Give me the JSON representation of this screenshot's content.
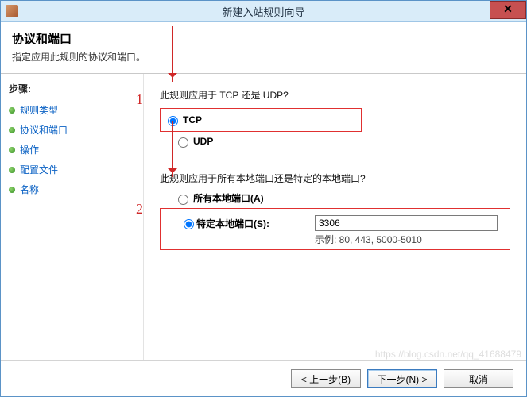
{
  "window": {
    "title": "新建入站规则向导",
    "close_glyph": "✕"
  },
  "header": {
    "title": "协议和端口",
    "subtitle": "指定应用此规则的协议和端口。"
  },
  "sidebar": {
    "label": "步骤:",
    "items": [
      {
        "label": "规则类型"
      },
      {
        "label": "协议和端口"
      },
      {
        "label": "操作"
      },
      {
        "label": "配置文件"
      },
      {
        "label": "名称"
      }
    ]
  },
  "content": {
    "q_protocol": "此规则应用于 TCP 还是 UDP?",
    "tcp_label": "TCP",
    "udp_label": "UDP",
    "q_port": "此规则应用于所有本地端口还是特定的本地端口?",
    "all_ports_label": "所有本地端口(A)",
    "specific_ports_label": "特定本地端口(S):",
    "port_value": "3306",
    "port_example": "示例: 80, 443, 5000-5010",
    "anno1": "1",
    "anno2": "2"
  },
  "footer": {
    "back": "< 上一步(B)",
    "next": "下一步(N) >",
    "cancel": "取消"
  },
  "watermark": "https://blog.csdn.net/qq_41688479"
}
